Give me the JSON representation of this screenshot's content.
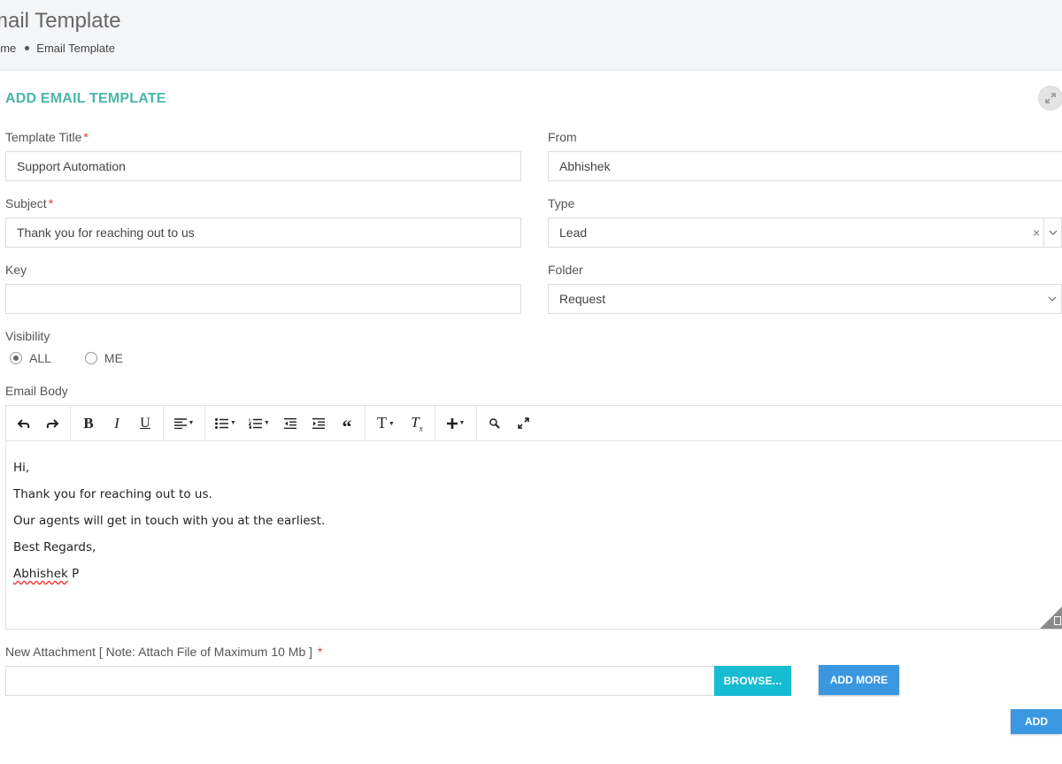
{
  "header": {
    "title": "mail Template",
    "breadcrumb": {
      "home": "ome",
      "current": "Email Template"
    }
  },
  "card": {
    "title": "ADD EMAIL TEMPLATE"
  },
  "form": {
    "template_title": {
      "label": "Template Title",
      "required": "*",
      "value": "Support Automation"
    },
    "from": {
      "label": "From",
      "value": "Abhishek"
    },
    "subject": {
      "label": "Subject",
      "required": "*",
      "value": "Thank you for reaching out to us"
    },
    "type": {
      "label": "Type",
      "value": "Lead",
      "clear": "×"
    },
    "key": {
      "label": "Key",
      "value": ""
    },
    "folder": {
      "label": "Folder",
      "value": "Request"
    },
    "visibility": {
      "label": "Visibility",
      "options": [
        "ALL",
        "ME"
      ],
      "selected": "ALL"
    },
    "email_body": {
      "label": "Email Body",
      "lines": [
        "Hi,",
        "Thank you for reaching out to us.",
        "Our agents will get in touch with you at the earliest.",
        "Best Regards,"
      ],
      "signature_name": "Abhishek",
      "signature_initial": " P"
    },
    "attachment": {
      "label": "New Attachment [ Note: Attach File of Maximum 10 Mb ]",
      "required": "*",
      "browse_label": "BROWSE...",
      "add_more_label": "ADD MORE"
    },
    "submit_label": "ADD"
  },
  "toolbar_icons": [
    "undo-icon",
    "redo-icon",
    "bold-icon",
    "italic-icon",
    "underline-icon",
    "align-icon",
    "bullet-list-icon",
    "numbered-list-icon",
    "outdent-icon",
    "indent-icon",
    "blockquote-icon",
    "font-size-icon",
    "clear-format-icon",
    "insert-icon",
    "search-icon",
    "fullscreen-icon"
  ],
  "colors": {
    "accent": "#4ab6a8",
    "primary_button": "#3b98e0",
    "browse_button": "#16bcd2",
    "required": "#e0383e"
  }
}
